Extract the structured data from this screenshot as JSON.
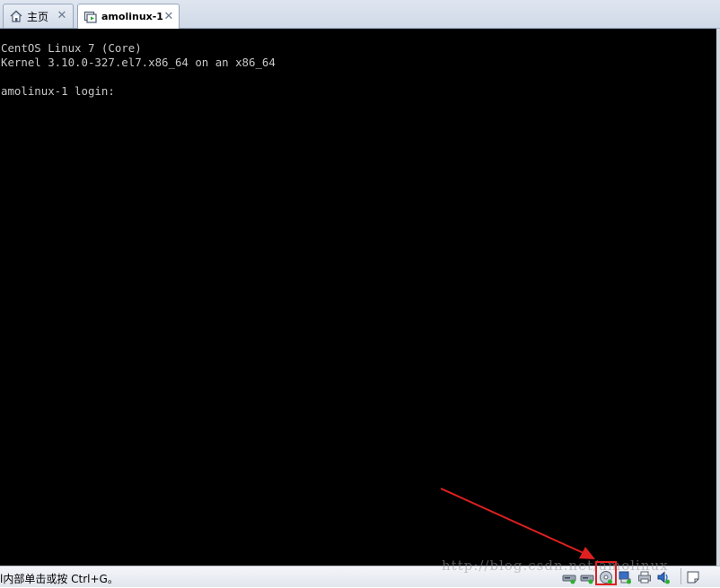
{
  "tabs": [
    {
      "label": "主页",
      "icon": "home-icon"
    },
    {
      "label": "amolinux-1",
      "icon": "vm-icon"
    }
  ],
  "console": {
    "lines": [
      "CentOS Linux 7 (Core)",
      "Kernel 3.10.0-327.el7.x86_64 on an x86_64",
      "amolinux-1 login:"
    ]
  },
  "status": {
    "text": "l内部单击或按 Ctrl+G。",
    "watermark": "http://blog.csdn.net/amolinux"
  },
  "devices": [
    {
      "name": "hard-disk-icon"
    },
    {
      "name": "hard-disk-2-icon"
    },
    {
      "name": "cd-dvd-icon"
    },
    {
      "name": "network-adapter-icon"
    },
    {
      "name": "printer-icon"
    },
    {
      "name": "sound-card-icon"
    },
    {
      "name": "message-icon"
    }
  ],
  "colors": {
    "console_bg": "#000000",
    "console_fg": "#c8c8c8",
    "highlight": "#e02020",
    "arrow": "#e02020"
  }
}
